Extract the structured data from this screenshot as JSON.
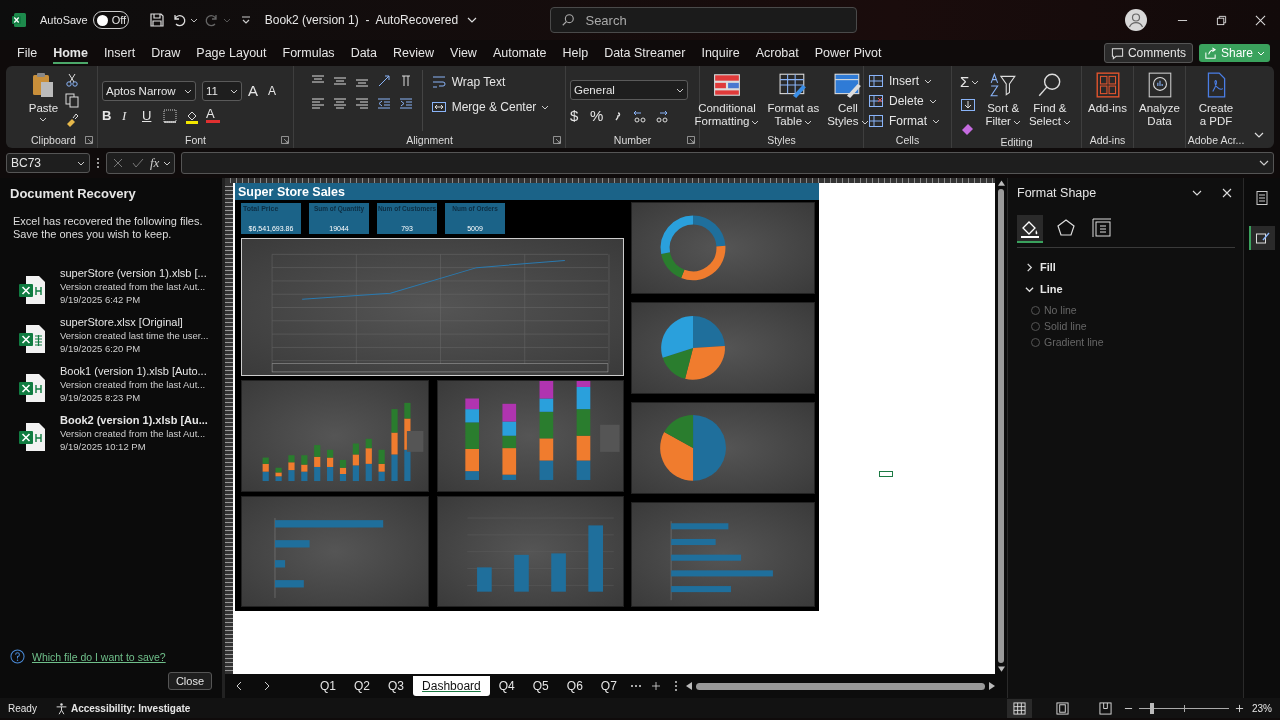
{
  "title_bar": {
    "autosave_label": "AutoSave",
    "autosave_on": false,
    "autosave_state": "Off",
    "document_title": "Book2 (version 1)  -  AutoRecovered",
    "search_placeholder": "Search"
  },
  "menu_tabs": [
    {
      "label": "File",
      "selected": false
    },
    {
      "label": "Home",
      "selected": true
    },
    {
      "label": "Insert",
      "selected": false
    },
    {
      "label": "Draw",
      "selected": false
    },
    {
      "label": "Page Layout",
      "selected": false
    },
    {
      "label": "Formulas",
      "selected": false
    },
    {
      "label": "Data",
      "selected": false
    },
    {
      "label": "Review",
      "selected": false
    },
    {
      "label": "View",
      "selected": false
    },
    {
      "label": "Automate",
      "selected": false
    },
    {
      "label": "Help",
      "selected": false
    },
    {
      "label": "Data Streamer",
      "selected": false
    },
    {
      "label": "Inquire",
      "selected": false
    },
    {
      "label": "Acrobat",
      "selected": false
    },
    {
      "label": "Power Pivot",
      "selected": false
    }
  ],
  "comments_button": "Comments",
  "share_button": "Share",
  "ribbon": {
    "clipboard": {
      "paste": "Paste",
      "label": "Clipboard"
    },
    "font": {
      "name": "Aptos Narrow",
      "size": "11",
      "bold": "B",
      "italic": "I",
      "underline": "U",
      "grow": "A",
      "shrink": "A",
      "font_color": "A",
      "label": "Font"
    },
    "alignment": {
      "wrap": "Wrap Text",
      "merge": "Merge & Center",
      "label": "Alignment"
    },
    "number": {
      "format": "General",
      "currency": "$",
      "percent": "%",
      "label": "Number"
    },
    "styles": {
      "buttons": [
        {
          "line1": "Conditional",
          "line2": "Formatting"
        },
        {
          "line1": "Format as",
          "line2": "Table"
        },
        {
          "line1": "Cell",
          "line2": "Styles"
        }
      ],
      "label": "Styles"
    },
    "cells": {
      "buttons": [
        "Insert",
        "Delete",
        "Format"
      ],
      "label": "Cells"
    },
    "editing": {
      "sum": "Σ",
      "sort": {
        "line1": "Sort &",
        "line2": "Filter"
      },
      "find": {
        "line1": "Find &",
        "line2": "Select"
      },
      "label": "Editing"
    },
    "addins": {
      "button": "Add-ins",
      "label": "Add-ins"
    },
    "analyze": {
      "line1": "Analyze",
      "line2": "Data"
    },
    "adobe": {
      "line1": "Create",
      "line2": "a PDF",
      "label": "Adobe Acr..."
    }
  },
  "formula_bar": {
    "name_box": "BC73",
    "fx": "fx"
  },
  "recovery": {
    "title": "Document Recovery",
    "intro": "Excel has recovered the following files. Save the ones you wish to keep.",
    "files": [
      {
        "name": "superStore (version 1).xlsb  [...",
        "description": "Version created from the last Aut...",
        "time": "9/19/2025 6:42 PM",
        "kind": "xlsb",
        "selected": false
      },
      {
        "name": "superStore.xlsx  [Original]",
        "description": "Version created last time the user...",
        "time": "9/19/2025 6:20 PM",
        "kind": "xlsx",
        "selected": false
      },
      {
        "name": "Book1 (version 1).xlsb  [Auto...",
        "description": "Version created from the last Aut...",
        "time": "9/19/2025 8:23 PM",
        "kind": "xlsb",
        "selected": false
      },
      {
        "name": "Book2 (version 1).xlsb  [Au...",
        "description": "Version created from the last Aut...",
        "time": "9/19/2025 10:12 PM",
        "kind": "xlsb",
        "selected": true
      }
    ],
    "help_link": "Which file do I want to save?",
    "close_button": "Close"
  },
  "dashboard": {
    "title": "Super Store Sales",
    "kpis": [
      {
        "label": "Total Price",
        "value": "$6,541,693.86"
      },
      {
        "label": "Sum of Quantity",
        "value": "19044"
      },
      {
        "label": "Num of Customers",
        "value": "793"
      },
      {
        "label": "Num of Orders",
        "value": "5009"
      }
    ]
  },
  "format_pane": {
    "title": "Format Shape",
    "sections": [
      {
        "label": "Fill",
        "expanded": false
      },
      {
        "label": "Line",
        "expanded": true
      }
    ],
    "line_options": [
      {
        "label": "No line",
        "selected": false,
        "disabled": true
      },
      {
        "label": "Solid line",
        "selected": false,
        "disabled": true
      },
      {
        "label": "Gradient line",
        "selected": false,
        "disabled": true
      }
    ]
  },
  "sheet_tabs": [
    {
      "label": "Q1",
      "selected": false
    },
    {
      "label": "Q2",
      "selected": false
    },
    {
      "label": "Q3",
      "selected": false
    },
    {
      "label": "Dashboard",
      "selected": true
    },
    {
      "label": "Q4",
      "selected": false
    },
    {
      "label": "Q5",
      "selected": false
    },
    {
      "label": "Q6",
      "selected": false
    },
    {
      "label": "Q7",
      "selected": false
    }
  ],
  "status_bar": {
    "ready": "Ready",
    "accessibility": "Accessibility: Investigate",
    "zoom": "23%",
    "zoom_slider": {
      "level": 0.12
    }
  }
}
